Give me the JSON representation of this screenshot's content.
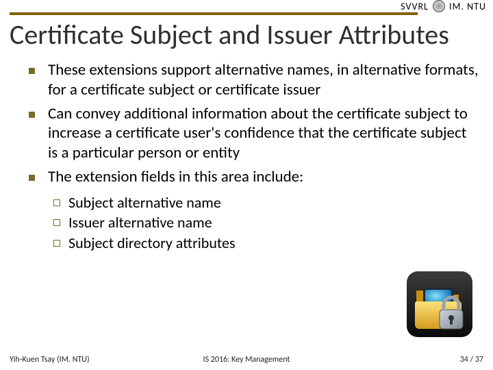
{
  "header": {
    "left_label": "SVVRL",
    "right_label": "IM. NTU"
  },
  "title": "Certificate Subject and Issuer Attributes",
  "bullets": [
    "These extensions support alternative names, in alternative formats, for a certificate subject or certificate issuer",
    "Can convey additional information about the certificate subject to increase a certificate user's confidence that the certificate subject is a particular person or entity",
    "The extension fields in this area include:"
  ],
  "sub_bullets": [
    "Subject alternative name",
    "Issuer alternative name",
    "Subject directory attributes"
  ],
  "footer": {
    "left": "Yih-Kuen Tsay (IM. NTU)",
    "center": "IS 2016: Key Management",
    "right": "34 / 37"
  },
  "clipart": {
    "name": "security-folder-lock"
  }
}
